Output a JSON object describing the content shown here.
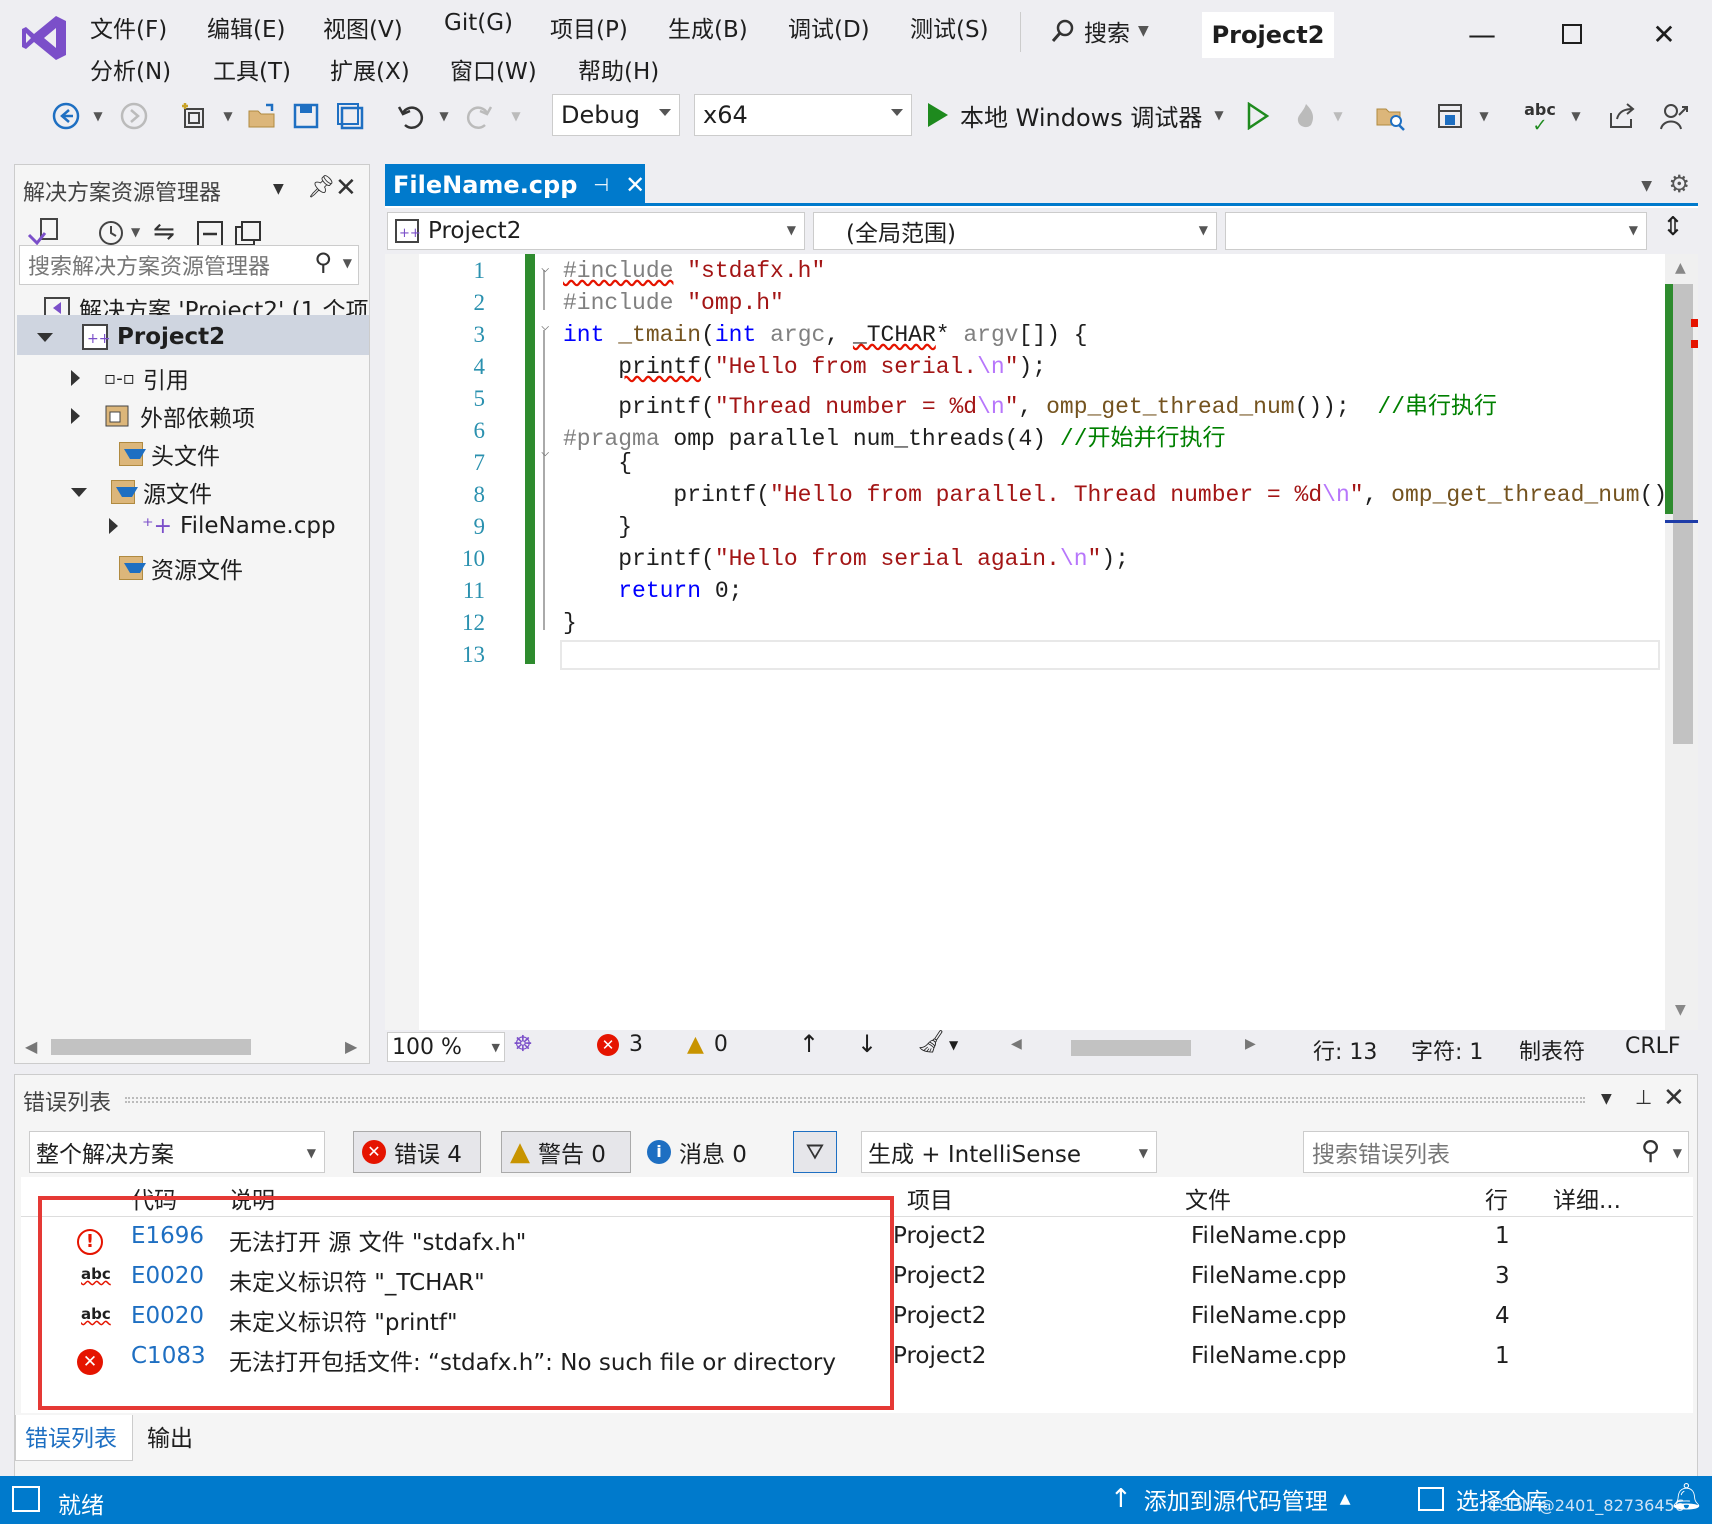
{
  "menu": {
    "row1": [
      "文件(F)",
      "编辑(E)",
      "视图(V)",
      "Git(G)",
      "项目(P)",
      "生成(B)",
      "调试(D)",
      "测试(S)"
    ],
    "row2": [
      "分析(N)",
      "工具(T)",
      "扩展(X)",
      "窗口(W)",
      "帮助(H)"
    ],
    "search": "搜索",
    "project_title": "Project2"
  },
  "toolbar": {
    "config": "Debug",
    "platform": "x64",
    "run_label": "本地 Windows 调试器"
  },
  "solution_explorer": {
    "title": "解决方案资源管理器",
    "search_placeholder": "搜索解决方案资源管理器",
    "items": [
      {
        "label": "解决方案 'Project2' (1 个项"
      },
      {
        "label": "Project2"
      },
      {
        "label": "引用"
      },
      {
        "label": "外部依赖项"
      },
      {
        "label": "头文件"
      },
      {
        "label": "源文件"
      },
      {
        "label": "FileName.cpp"
      },
      {
        "label": "资源文件"
      }
    ]
  },
  "editor": {
    "tab": "FileName.cpp",
    "nav_project": "Project2",
    "nav_scope": "(全局范围)",
    "zoom": "100 %",
    "errors": "3",
    "warnings": "0",
    "line": "行: 13",
    "char": "字符: 1",
    "tabs": "制表符",
    "eol": "CRLF",
    "line_numbers": [
      "1",
      "2",
      "3",
      "4",
      "5",
      "6",
      "7",
      "8",
      "9",
      "10",
      "11",
      "12",
      "13"
    ]
  },
  "error_list": {
    "title": "错误列表",
    "scope": "整个解决方案",
    "errors_btn": "错误 4",
    "warnings_btn": "警告 0",
    "messages_btn": "消息 0",
    "source": "生成 + IntelliSense",
    "search_placeholder": "搜索错误列表",
    "headers": {
      "code": "代码",
      "desc": "说明",
      "project": "项目",
      "file": "文件",
      "line": "行",
      "detail": "详细..."
    },
    "rows": [
      {
        "icon": "error-circle-outline-icon",
        "code": "E1696",
        "desc": "无法打开 源 文件 \"stdafx.h\"",
        "project": "Project2",
        "file": "FileName.cpp",
        "line": "1"
      },
      {
        "icon": "spellcheck-icon",
        "code": "E0020",
        "desc": "未定义标识符 \"_TCHAR\"",
        "project": "Project2",
        "file": "FileName.cpp",
        "line": "3"
      },
      {
        "icon": "spellcheck-icon",
        "code": "E0020",
        "desc": "未定义标识符 \"printf\"",
        "project": "Project2",
        "file": "FileName.cpp",
        "line": "4"
      },
      {
        "icon": "error-icon",
        "code": "C1083",
        "desc": "无法打开包括文件: “stdafx.h”: No such file or directory",
        "project": "Project2",
        "file": "FileName.cpp",
        "line": "1"
      }
    ],
    "tab_errors": "错误列表",
    "tab_output": "输出"
  },
  "statusbar": {
    "ready": "就绪",
    "add_source": "添加到源代码管理",
    "select_repo": "选择仓库",
    "watermark": "CSDN @2401_82736456"
  },
  "colors": {
    "accent": "#007acc",
    "error": "#e51400",
    "highlight": "#e53935"
  }
}
